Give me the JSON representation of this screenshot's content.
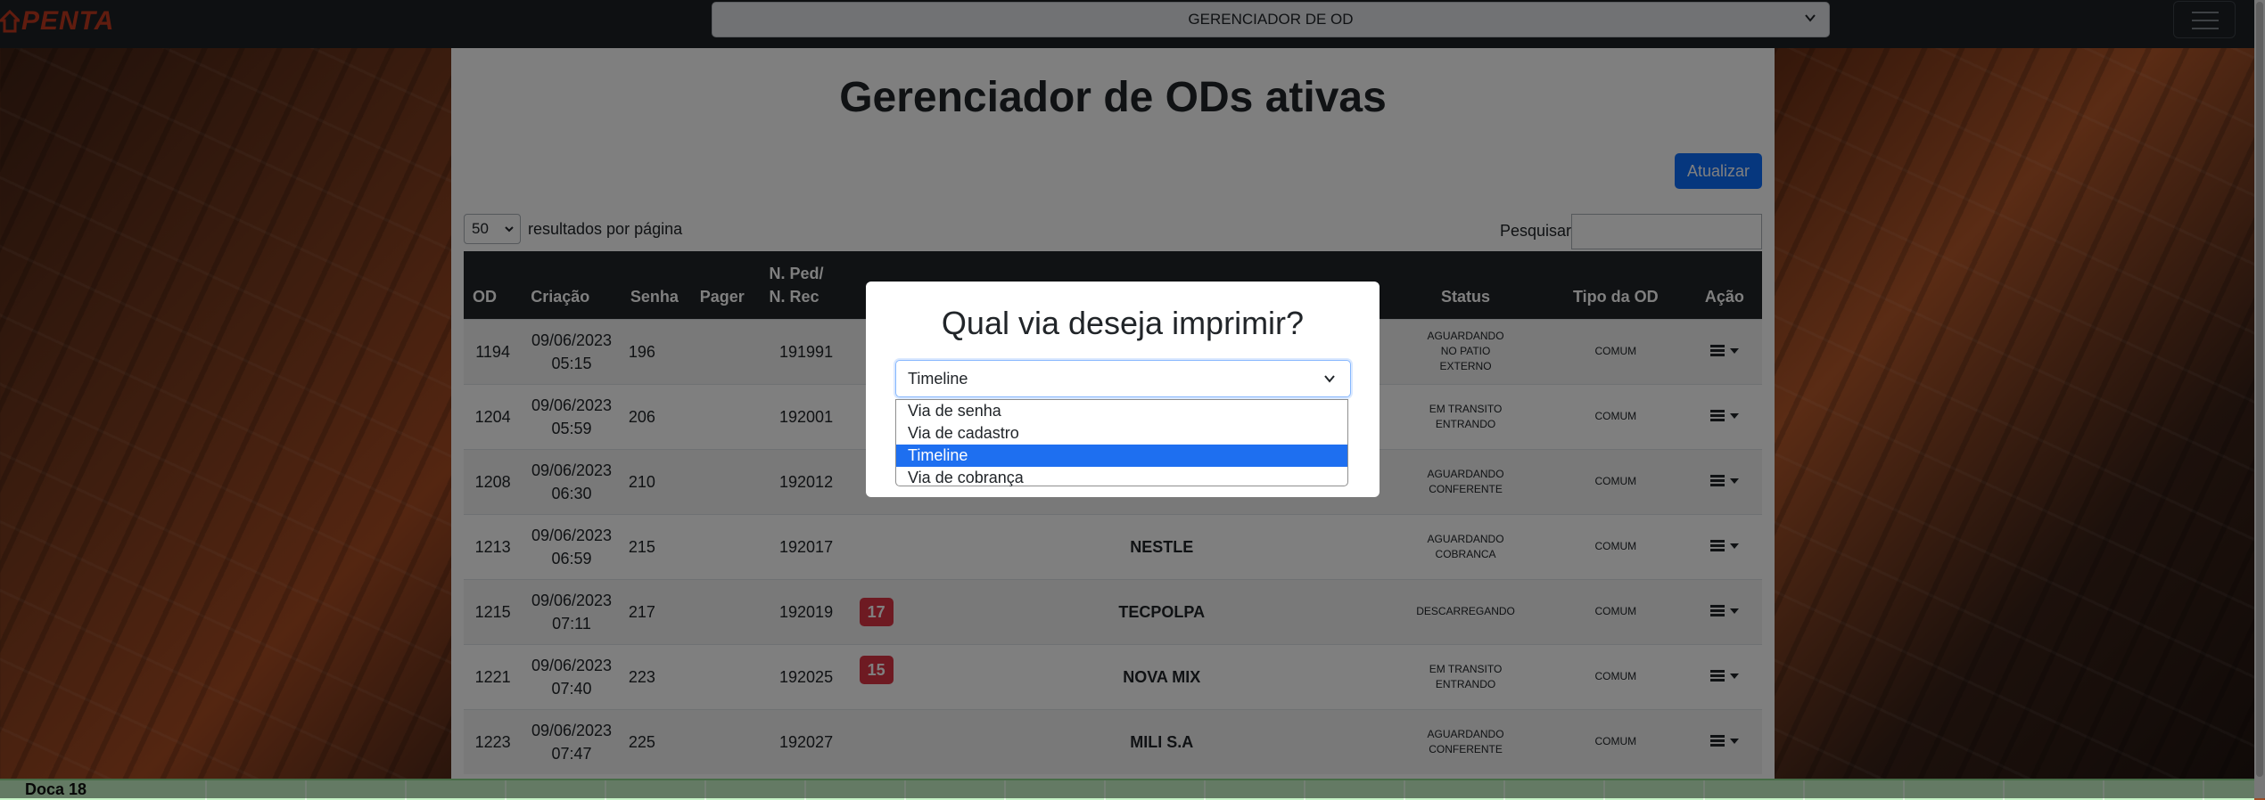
{
  "navbar": {
    "brand": "PENTA",
    "page_select_value": "GERENCIADOR DE OD"
  },
  "panel": {
    "title": "Gerenciador de ODs ativas",
    "update_button": "Atualizar",
    "page_length_value": "50",
    "page_length_label": "resultados por página",
    "search_label": "Pesquisar",
    "search_value": ""
  },
  "table": {
    "headers": [
      "OD",
      "Criação",
      "Senha",
      "Pager",
      "N. Ped/ N. Rec",
      "",
      "",
      "Status",
      "Tipo da OD",
      "Ação"
    ],
    "header_ped_line1": "N. Ped/",
    "header_ped_line2": "N. Rec",
    "rows": [
      {
        "od": "1194",
        "date": "09/06/2023",
        "time": "05:15",
        "senha": "196",
        "pager": "",
        "ped": "191991",
        "badge": "",
        "cliente": "",
        "status1": "AGUARDANDO",
        "status2": "NO PATIO",
        "status3": "EXTERNO",
        "tipo": "COMUM"
      },
      {
        "od": "1204",
        "date": "09/06/2023",
        "time": "05:59",
        "senha": "206",
        "pager": "",
        "ped": "192001",
        "badge": "",
        "cliente": "",
        "status1": "EM TRANSITO",
        "status2": "ENTRANDO",
        "status3": "",
        "tipo": "COMUM"
      },
      {
        "od": "1208",
        "date": "09/06/2023",
        "time": "06:30",
        "senha": "210",
        "pager": "",
        "ped": "192012",
        "badge": "",
        "cliente": "",
        "status1": "AGUARDANDO",
        "status2": "CONFERENTE",
        "status3": "",
        "tipo": "COMUM"
      },
      {
        "od": "1213",
        "date": "09/06/2023",
        "time": "06:59",
        "senha": "215",
        "pager": "",
        "ped": "192017",
        "badge": "",
        "cliente": "NESTLE",
        "status1": "AGUARDANDO",
        "status2": "COBRANCA",
        "status3": "",
        "tipo": "COMUM"
      },
      {
        "od": "1215",
        "date": "09/06/2023",
        "time": "07:11",
        "senha": "217",
        "pager": "",
        "ped": "192019",
        "badge": "17",
        "cliente": "TECPOLPA",
        "status1": "DESCARREGANDO",
        "status2": "",
        "status3": "",
        "tipo": "COMUM"
      },
      {
        "od": "1221",
        "date": "09/06/2023",
        "time": "07:40",
        "senha": "223",
        "pager": "",
        "ped": "192025",
        "badge": "15",
        "cliente": "NOVA MIX",
        "status1": "EM TRANSITO",
        "status2": "ENTRANDO",
        "status3": "",
        "tipo": "COMUM"
      },
      {
        "od": "1223",
        "date": "09/06/2023",
        "time": "07:47",
        "senha": "225",
        "pager": "",
        "ped": "192027",
        "badge": "",
        "cliente": "MILI S.A",
        "status1": "AGUARDANDO",
        "status2": "CONFERENTE",
        "status3": "",
        "tipo": "COMUM"
      }
    ]
  },
  "modal": {
    "title": "Qual via deseja imprimir?",
    "selected": "Timeline",
    "options": [
      "Via de senha",
      "Via de cadastro",
      "Timeline",
      "Via de cobrança"
    ]
  },
  "footer": {
    "label": "Doca 18"
  },
  "colors": {
    "primary": "#0d6efd",
    "badge": "#dc3545",
    "brand": "#c0391e",
    "table_header": "#212529",
    "footer": "#c8f5c8"
  }
}
